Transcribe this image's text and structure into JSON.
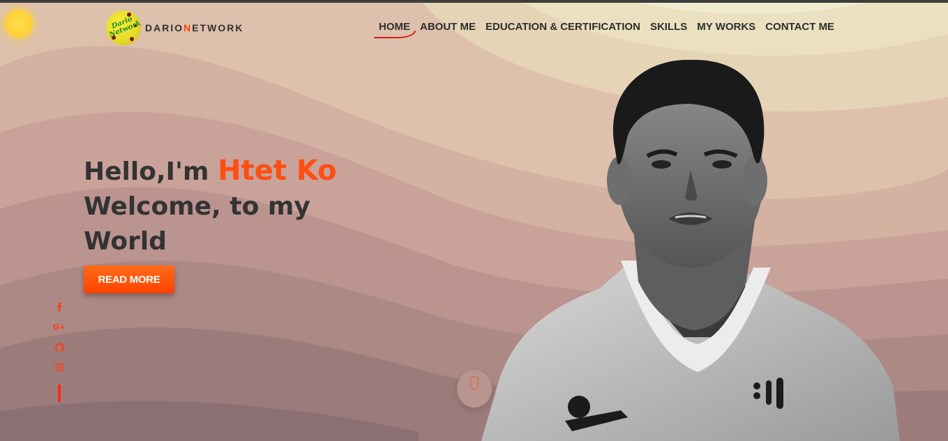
{
  "brand": {
    "badge_text": "Dario Network",
    "name_part1": "DARIO",
    "name_accent": "N",
    "name_part2": "ETWORK",
    "accent_color": "#ff3c0f"
  },
  "nav": {
    "items": [
      {
        "label": "HOME",
        "active": true
      },
      {
        "label": "ABOUT ME"
      },
      {
        "label": "EDUCATION & CERTIFICATION"
      },
      {
        "label": "SKILLS"
      },
      {
        "label": "MY WORKS"
      },
      {
        "label": "CONTACT ME"
      }
    ]
  },
  "hero": {
    "greeting": "Hello,I'm ",
    "name": "Htet Ko",
    "subtitle": "Welcome, to my World",
    "button_label": "READ MORE",
    "name_color": "#ff4e12"
  },
  "social": {
    "icons": [
      {
        "name": "facebook-icon",
        "glyph": "f"
      },
      {
        "name": "google-plus-icon",
        "glyph": "G+"
      },
      {
        "name": "github-icon",
        "glyph": "github"
      },
      {
        "name": "instagram-icon",
        "glyph": "instagram"
      }
    ]
  },
  "icons": {
    "theme_toggle": "sun-icon",
    "scroll_down": "mouse-scroll-icon"
  }
}
